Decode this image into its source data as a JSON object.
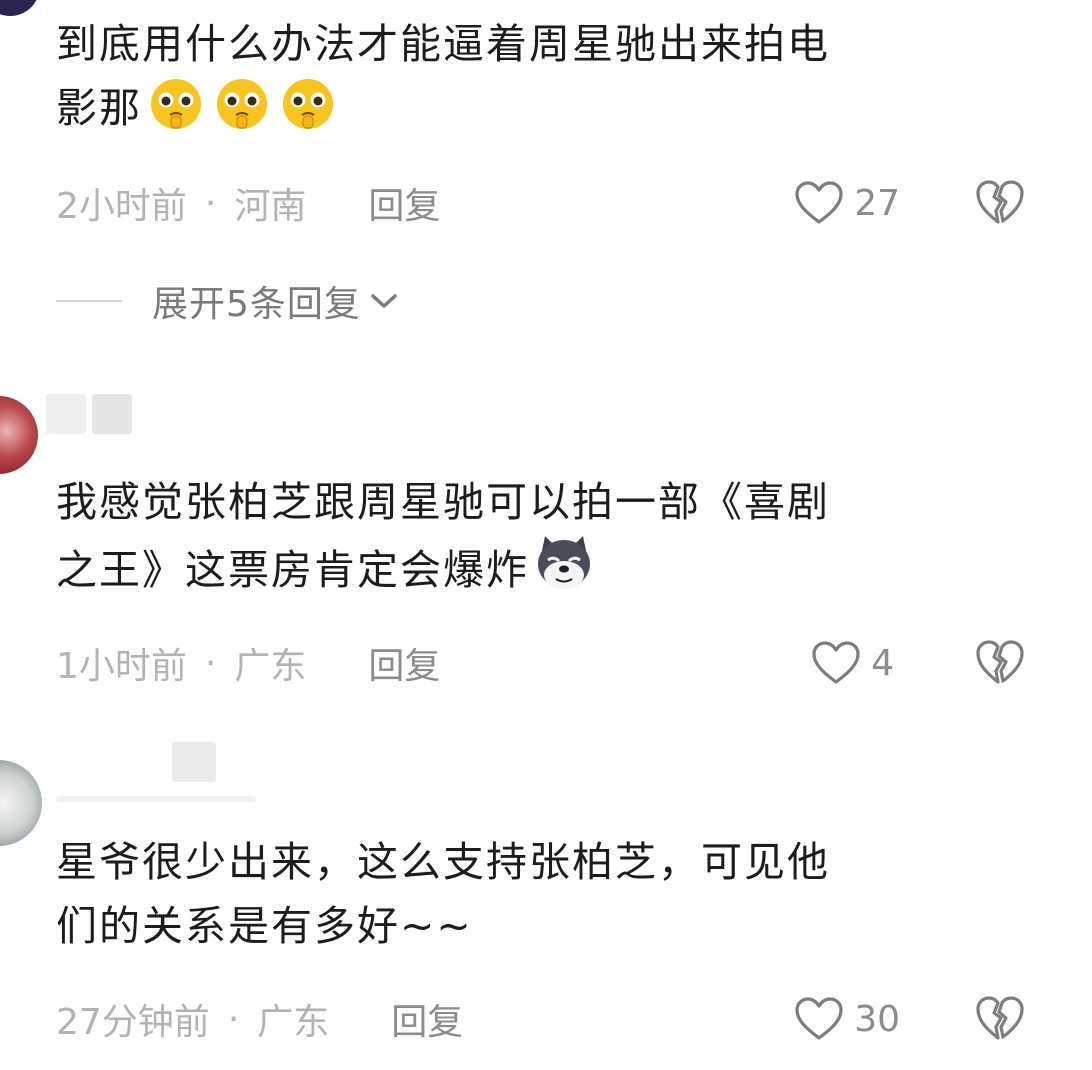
{
  "comments": [
    {
      "text_line1": "到底用什么办法才能逼着周星驰出来拍电",
      "text_line2": "影那",
      "emojis": [
        "pleading-face-emoji",
        "pleading-face-emoji",
        "pleading-face-emoji"
      ],
      "time": "2小时前",
      "separator": "·",
      "location": "河南",
      "reply_label": "回复",
      "likes": "27",
      "expand_label": "展开5条回复"
    },
    {
      "text_line1": "我感觉张柏芝跟周星驰可以拍一部《喜剧",
      "text_line2": "之王》这票房肯定会爆炸",
      "emojis": [
        "smug-dog-emoji"
      ],
      "time": "1小时前",
      "separator": "·",
      "location": "广东",
      "reply_label": "回复",
      "likes": "4"
    },
    {
      "text_line1": "星爷很少出来，这么支持张柏芝，可见他",
      "text_line2": "们的关系是有多好~~",
      "time": "27分钟前",
      "separator": "·",
      "location": "广东",
      "reply_label": "回复",
      "likes": "30"
    }
  ],
  "icons": {
    "like": "heart-outline-icon",
    "dislike": "broken-heart-icon",
    "expand": "chevron-down-icon"
  },
  "colors": {
    "text": "#1c1c1c",
    "meta": "#b3b3b3",
    "action": "#8c8c8c"
  }
}
